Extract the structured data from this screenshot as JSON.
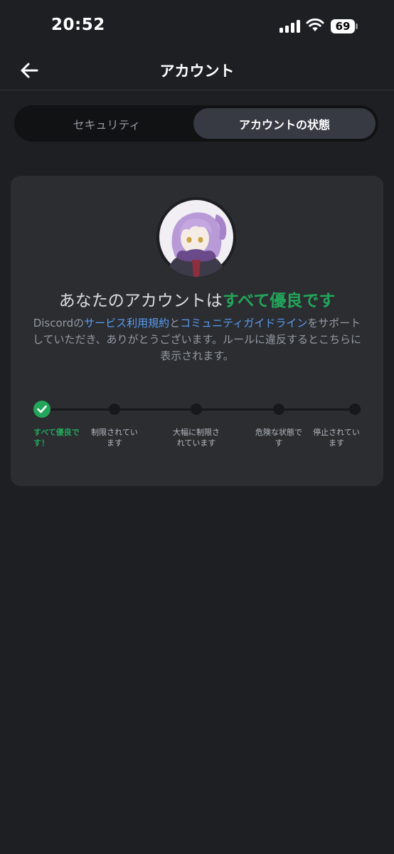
{
  "status_bar": {
    "time": "20:52",
    "battery": "69",
    "icons": [
      "signal-icon",
      "wifi-icon",
      "battery-icon"
    ]
  },
  "header": {
    "title": "アカウント",
    "back_icon": "arrow-left-icon"
  },
  "tabs": [
    {
      "label": "セキュリティ",
      "selected": false
    },
    {
      "label": "アカウントの状態",
      "selected": true
    }
  ],
  "account_status": {
    "heading_prefix": "あなたのアカウントは",
    "heading_status": "すべて優良です",
    "desc_part1": "Discordの",
    "desc_link1": "サービス利用規約",
    "desc_part2": "と",
    "desc_link2": "コミュニティガイドライン",
    "desc_part3": "をサポートしていただき、ありがとうございます。ルールに違反するとこちらに表示されます。",
    "steps": [
      {
        "line1": "すべて優良で",
        "line2": "す！",
        "active": true
      },
      {
        "line1": "制限されてい",
        "line2": "ます",
        "active": false
      },
      {
        "line1": "大幅に制限さ",
        "line2": "れています",
        "active": false
      },
      {
        "line1": "危険な状態で",
        "line2": "す",
        "active": false
      },
      {
        "line1": "停止されてい",
        "line2": "ます",
        "active": false
      }
    ]
  },
  "colors": {
    "background": "#1e1f22",
    "card": "#2b2d31",
    "good": "#23a55a",
    "link": "#5a9cf2",
    "muted": "#949ba4"
  }
}
